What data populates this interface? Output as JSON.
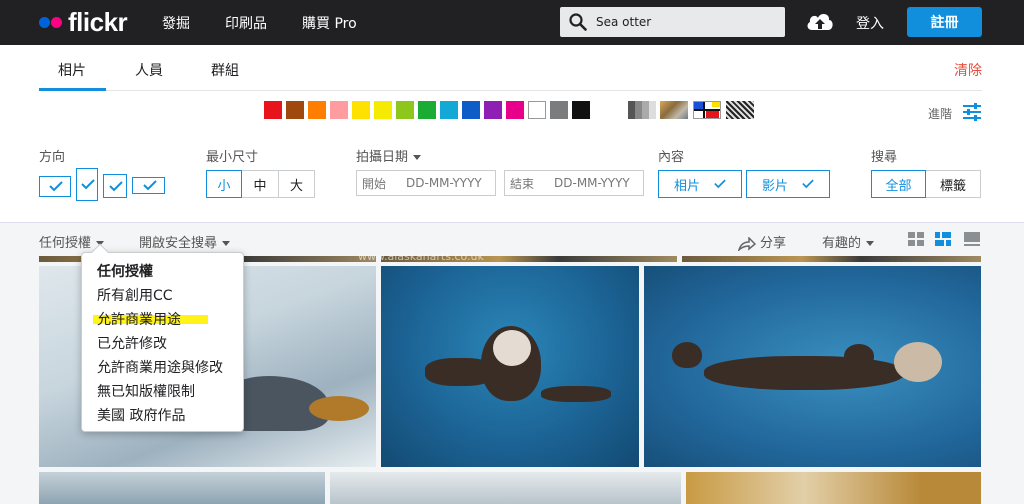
{
  "header": {
    "logo": "flickr",
    "nav": [
      "發掘",
      "印刷品",
      "購買 Pro"
    ],
    "search_value": "Sea otter",
    "login": "登入",
    "signup": "註冊"
  },
  "tabs": [
    {
      "label": "相片",
      "active": true
    },
    {
      "label": "人員",
      "active": false
    },
    {
      "label": "群組",
      "active": false
    }
  ],
  "clear_label": "清除",
  "advanced_label": "進階",
  "colors": [
    "#e8141c",
    "#a0490f",
    "#ff7e00",
    "#ff9c9f",
    "#ffe100",
    "#f5eb00",
    "#8dc71d",
    "#1bac36",
    "#12a9d6",
    "#0e5cc7",
    "#8f1fb4",
    "#e8008a",
    "#ffffff",
    "#7b7c7e",
    "#111111"
  ],
  "filters": {
    "orientation_label": "方向",
    "min_size_label": "最小尺寸",
    "sizes": [
      "小",
      "中",
      "大"
    ],
    "date_label": "拍攝日期",
    "date_start_label": "開始",
    "date_end_label": "結束",
    "date_format": "DD-MM-YYYY",
    "content_label": "內容",
    "content_photos": "相片",
    "content_videos": "影片",
    "search_label": "搜尋",
    "search_all": "全部",
    "search_tags": "標籤"
  },
  "toolbar": {
    "license": "任何授權",
    "safe_search": "開啟安全搜尋",
    "share": "分享",
    "sort": "有趣的"
  },
  "watermark": "www.alaskanarts.co.uk",
  "license_menu": {
    "items": [
      "任何授權",
      "所有創用CC",
      "允許商業用途",
      "已允許修改",
      "允許商業用途與修改",
      "無已知版權限制",
      "美國 政府作品"
    ],
    "highlighted_index": 2
  }
}
